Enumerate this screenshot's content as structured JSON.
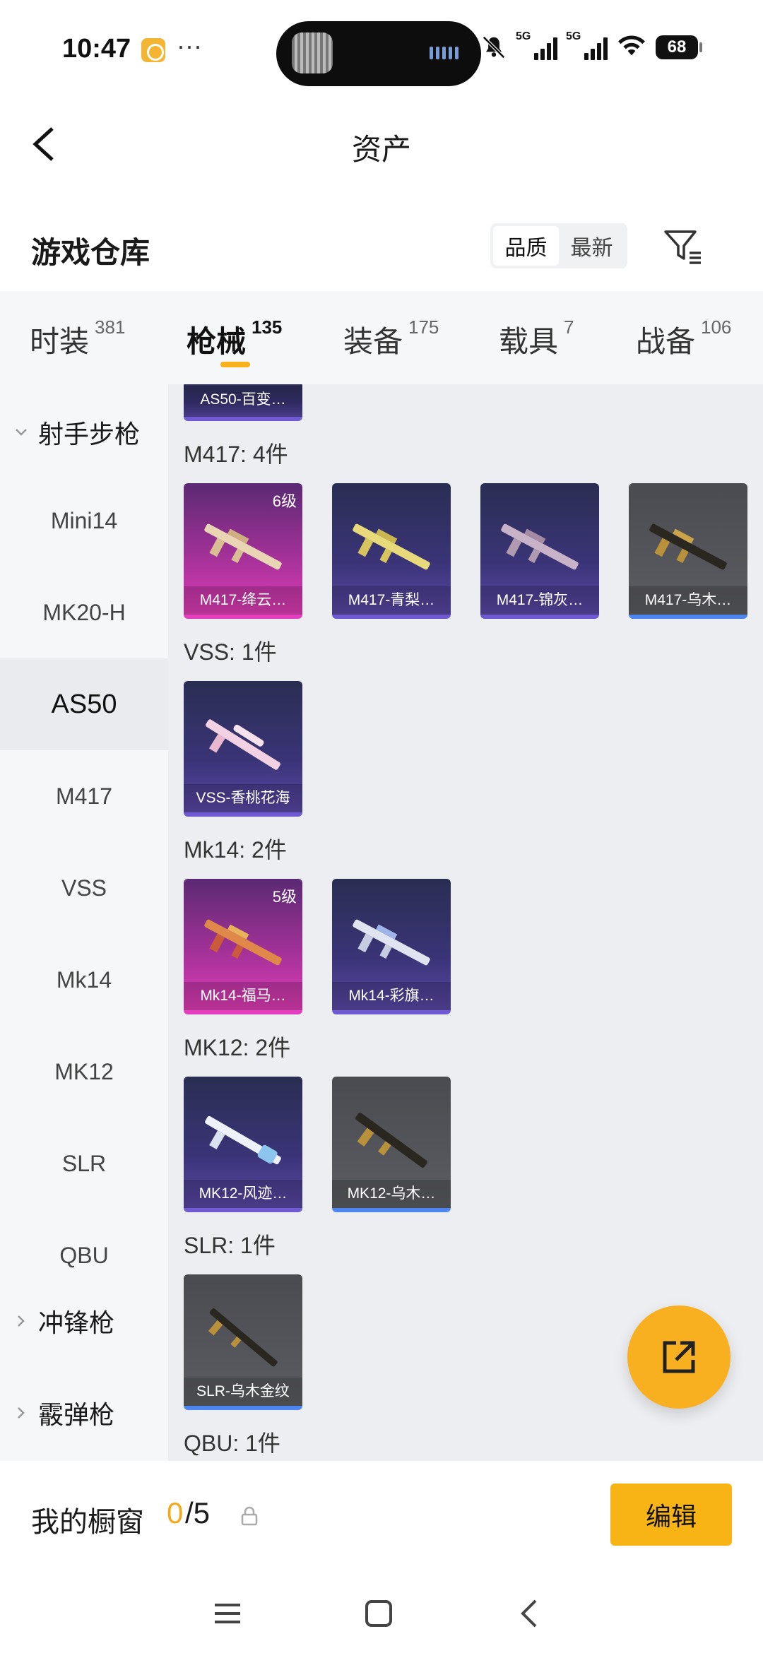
{
  "status_bar": {
    "time": "10:47",
    "more": "···",
    "network_1": "5G",
    "network_2": "5G",
    "battery": "68"
  },
  "header": {
    "title": "资产"
  },
  "warehouse": {
    "title": "游戏仓库",
    "sort_options": [
      "品质",
      "最新"
    ],
    "active_sort": "品质"
  },
  "tabs": [
    {
      "label": "时装",
      "count": "381"
    },
    {
      "label": "枪械",
      "count": "135",
      "active": true
    },
    {
      "label": "装备",
      "count": "175"
    },
    {
      "label": "载具",
      "count": "7"
    },
    {
      "label": "战备",
      "count": "106"
    }
  ],
  "sidebar": {
    "group_marksman": "射手步枪",
    "items": [
      "Mini14",
      "MK20-H",
      "AS50",
      "M417",
      "VSS",
      "Mk14",
      "MK12",
      "SLR",
      "QBU"
    ],
    "active_item": "AS50",
    "group_smg": "冲锋枪",
    "group_shotgun": "霰弹枪"
  },
  "content": {
    "top_card": "AS50-百变…",
    "sections": [
      {
        "title": "M417: 4件",
        "cards": [
          {
            "name": "M417-绛云…",
            "level": "6级",
            "tier": "pink"
          },
          {
            "name": "M417-青梨…",
            "tier": "purple"
          },
          {
            "name": "M417-锦灰…",
            "tier": "purple"
          },
          {
            "name": "M417-乌木…",
            "tier": "gray"
          }
        ]
      },
      {
        "title": "VSS: 1件",
        "cards": [
          {
            "name": "VSS-香桃花海",
            "tier": "purple"
          }
        ]
      },
      {
        "title": "Mk14: 2件",
        "cards": [
          {
            "name": "Mk14-福马…",
            "level": "5级",
            "tier": "pink"
          },
          {
            "name": "Mk14-彩旗…",
            "tier": "purple"
          }
        ]
      },
      {
        "title": "MK12: 2件",
        "cards": [
          {
            "name": "MK12-风迹…",
            "tier": "purple"
          },
          {
            "name": "MK12-乌木…",
            "tier": "gray"
          }
        ]
      },
      {
        "title": "SLR: 1件",
        "cards": [
          {
            "name": "SLR-乌木金纹",
            "tier": "gray"
          }
        ]
      },
      {
        "title": "QBU: 1件",
        "cards": []
      }
    ]
  },
  "showcase": {
    "label": "我的橱窗",
    "count": "0",
    "total": "/5",
    "edit_label": "编辑"
  },
  "colors": {
    "accent": "#f8b414",
    "tier_pink": "#e33fbf",
    "tier_purple": "#6f5ad3",
    "tier_gray_border": "#4d86f0"
  }
}
